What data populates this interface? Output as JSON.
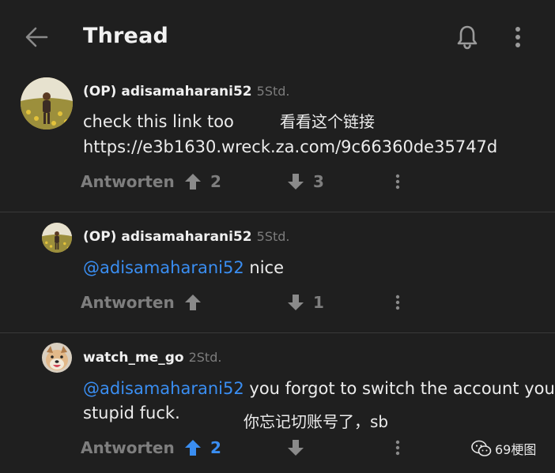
{
  "header": {
    "title": "Thread",
    "back_icon": "arrow-left-icon",
    "bell_icon": "bell-icon",
    "more_icon": "more-vertical-icon"
  },
  "colors": {
    "background": "#1f1f1f",
    "accent": "#3a8ef2",
    "muted": "#7e7e7e"
  },
  "comments": [
    {
      "author": "(OP) adisamaharani52",
      "time": "5Std.",
      "lines": [
        "check this link too",
        "https://e3b1630.wreck.za.com/9c66360de35747d"
      ],
      "annotation": "看看这个链接",
      "reply_label": "Antworten",
      "upvotes": "2",
      "downvotes": "3"
    },
    {
      "author": "(OP) adisamaharani52",
      "time": "5Std.",
      "mention": "@adisamaharani52",
      "text": " nice",
      "reply_label": "Antworten",
      "upvotes": "",
      "downvotes": "1"
    },
    {
      "author": "watch_me_go",
      "time": "2Std.",
      "mention": "@adisamaharani52",
      "text": " you forgot to switch the account you",
      "line2": "stupid fuck.",
      "annotation": "你忘记切账号了，sb",
      "reply_label": "Antworten",
      "upvotes": "2",
      "upvote_active": true,
      "downvotes": ""
    }
  ],
  "watermark": {
    "icon": "wechat-icon",
    "text": "69梗图"
  }
}
